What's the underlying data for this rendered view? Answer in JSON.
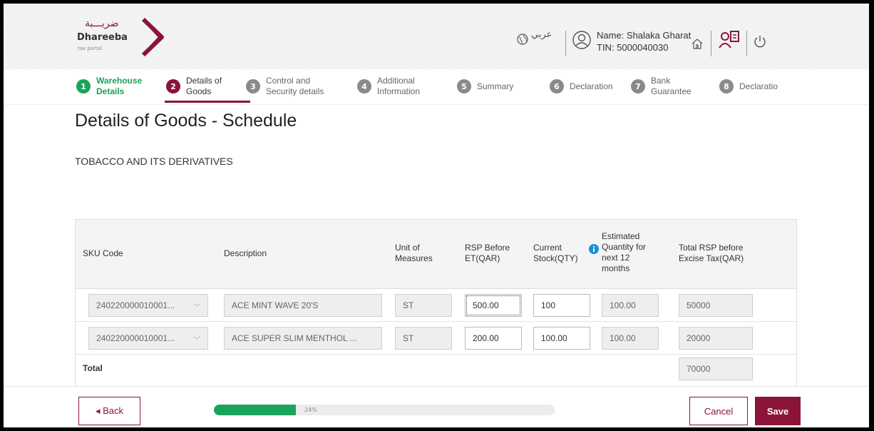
{
  "header": {
    "logo_arabic": "ضريـــبة",
    "logo_name": "Dhareeba",
    "logo_sub": "tax portal",
    "language_label": "عربي",
    "user_name": "Name: Shalaka Gharat",
    "user_tin": "TIN: 5000040030"
  },
  "steps": [
    {
      "num": "1",
      "label": "Warehouse\nDetails",
      "state": "done"
    },
    {
      "num": "2",
      "label": "Details of\nGoods",
      "state": "active"
    },
    {
      "num": "3",
      "label": "Control and\nSecurity details",
      "state": "todo"
    },
    {
      "num": "4",
      "label": "Additional\nInformation",
      "state": "todo"
    },
    {
      "num": "5",
      "label": "Summary",
      "state": "todo"
    },
    {
      "num": "6",
      "label": "Declaration",
      "state": "todo"
    },
    {
      "num": "7",
      "label": "Bank\nGuarantee",
      "state": "todo"
    },
    {
      "num": "8",
      "label": "Declaratio",
      "state": "todo"
    }
  ],
  "page": {
    "title": "Details of Goods - Schedule",
    "section": "TOBACCO AND ITS DERIVATIVES"
  },
  "table": {
    "headers": {
      "sku": "SKU Code",
      "description": "Description",
      "unit": "Unit of\nMeasures",
      "rsp": "RSP Before\nET(QAR)",
      "stock": "Current\nStock(QTY)",
      "estimated": "Estimated\nQuantity for\nnext 12\nmonths",
      "total_rsp": "Total RSP before\nExcise Tax(QAR)"
    },
    "rows": [
      {
        "sku": "240220000010001...",
        "description": "ACE MINT WAVE 20'S",
        "unit": "ST",
        "rsp": "500.00",
        "stock": "100",
        "estimated": "100.00",
        "total_rsp": "50000"
      },
      {
        "sku": "240220000010001...",
        "description": "ACE SUPER SLIM MENTHOL ...",
        "unit": "ST",
        "rsp": "200.00",
        "stock": "100.00",
        "estimated": "100.00",
        "total_rsp": "20000"
      }
    ],
    "total_label": "Total",
    "total_value": "70000"
  },
  "footer": {
    "back_label": "◂  Back",
    "progress_text": "24%",
    "progress_value": 0.24,
    "cancel_label": "Cancel",
    "save_label": "Save"
  },
  "colors": {
    "brand": "#8a1538",
    "success": "#19a45a",
    "info": "#1a8fd8"
  }
}
